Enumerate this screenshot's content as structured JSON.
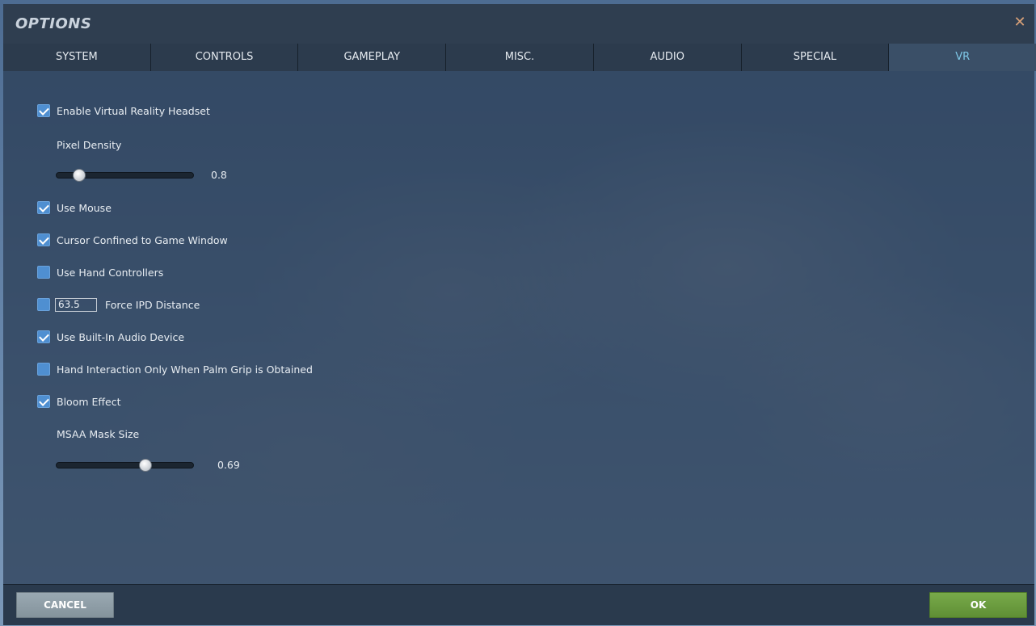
{
  "dialog": {
    "title": "OPTIONS",
    "close_icon": "close-icon",
    "accent_color": "#7ec7e6"
  },
  "tabs": [
    {
      "label": "SYSTEM"
    },
    {
      "label": "CONTROLS"
    },
    {
      "label": "GAMEPLAY"
    },
    {
      "label": "MISC."
    },
    {
      "label": "AUDIO"
    },
    {
      "label": "SPECIAL"
    },
    {
      "label": "VR",
      "active": true
    }
  ],
  "vr": {
    "enable_headset": {
      "label": "Enable Virtual Reality Headset",
      "checked": true
    },
    "pixel_density": {
      "label": "Pixel Density",
      "value": "0.8",
      "fraction": 0.17
    },
    "use_mouse": {
      "label": "Use Mouse",
      "checked": true
    },
    "cursor_confined": {
      "label": "Cursor Confined to Game Window",
      "checked": true
    },
    "hand_controllers": {
      "label": "Use Hand Controllers",
      "checked": false
    },
    "force_ipd": {
      "label": "Force IPD Distance",
      "checked": false,
      "value": "63.5"
    },
    "builtin_audio": {
      "label": "Use Built-In Audio Device",
      "checked": true
    },
    "palm_grip": {
      "label": "Hand Interaction Only When Palm Grip is Obtained",
      "checked": false
    },
    "bloom": {
      "label": "Bloom Effect",
      "checked": true
    },
    "msaa_mask": {
      "label": "MSAA Mask Size",
      "value": "0.69",
      "fraction": 0.65
    }
  },
  "footer": {
    "cancel_label": "CANCEL",
    "ok_label": "OK"
  }
}
